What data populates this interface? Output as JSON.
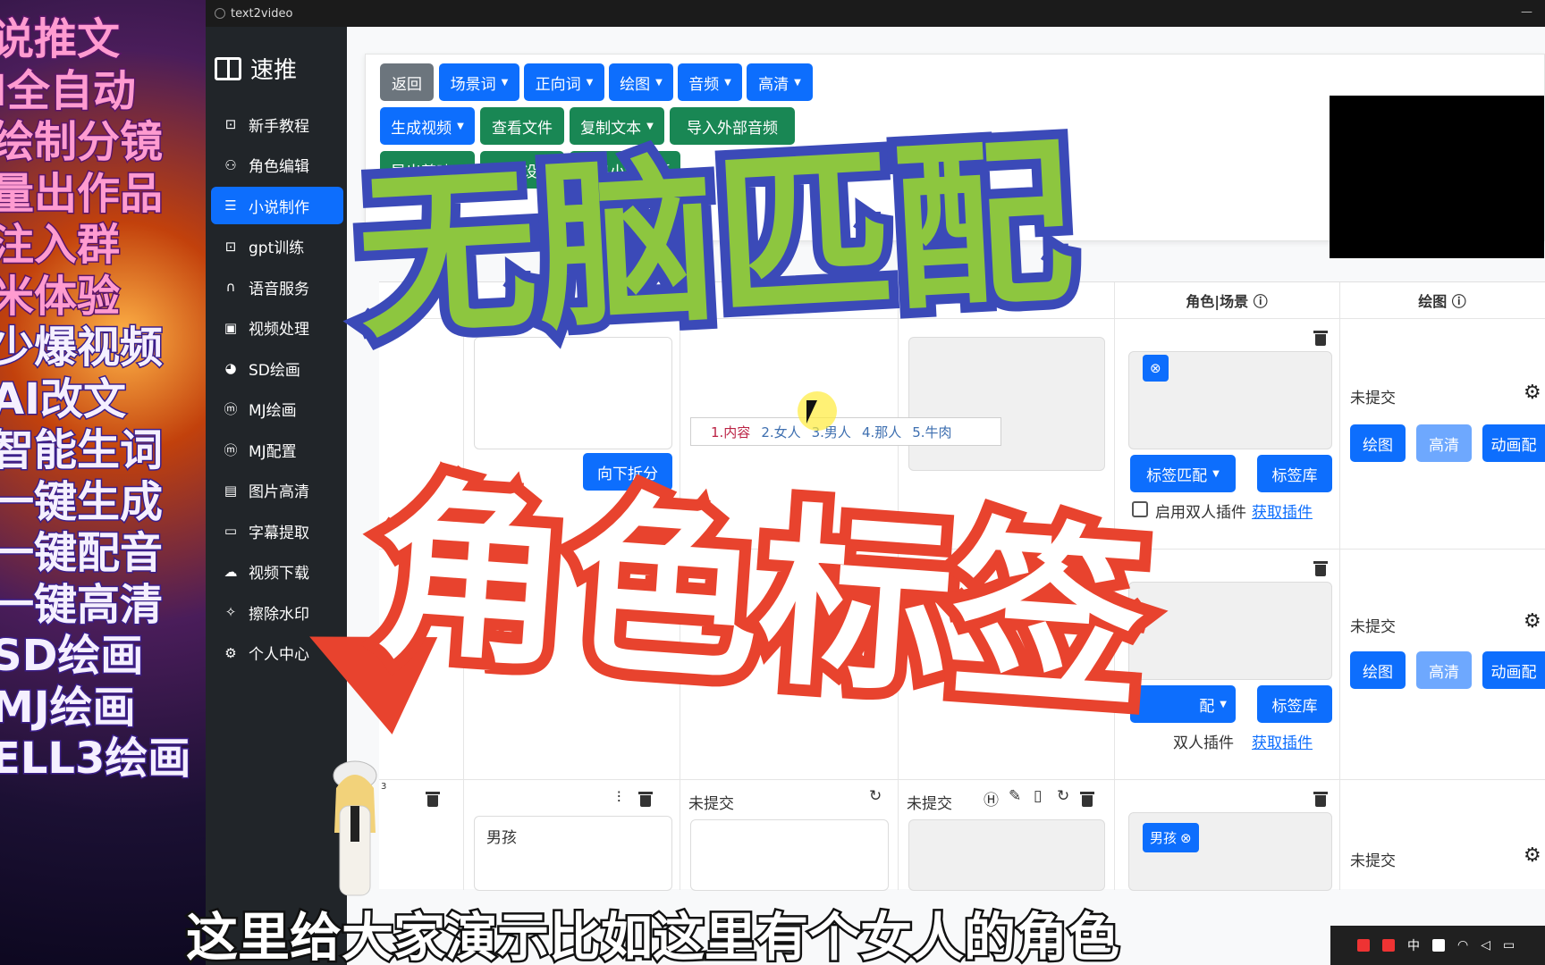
{
  "promo": {
    "lines": [
      "说推文",
      "I全自动",
      "绘制分镜",
      "量出作品",
      "注入群",
      "米体验",
      "少爆视频",
      "AI改文",
      "智能生词",
      "一键生成",
      "一键配音",
      "一键高清",
      "SD绘画",
      "MJ绘画",
      "ELL3绘画"
    ]
  },
  "window": {
    "title": "text2video"
  },
  "sidebar": {
    "brand": "速推",
    "items": [
      {
        "label": "新手教程",
        "icon": "robot-icon"
      },
      {
        "label": "角色编辑",
        "icon": "users-icon"
      },
      {
        "label": "小说制作",
        "icon": "list-icon",
        "active": true
      },
      {
        "label": "gpt训练",
        "icon": "robot-icon"
      },
      {
        "label": "语音服务",
        "icon": "headphones-icon"
      },
      {
        "label": "视频处理",
        "icon": "video-icon"
      },
      {
        "label": "SD绘画",
        "icon": "palette-icon"
      },
      {
        "label": "MJ绘画",
        "icon": "mastodon-icon"
      },
      {
        "label": "MJ配置",
        "icon": "mastodon-icon"
      },
      {
        "label": "图片高清",
        "icon": "8k-icon"
      },
      {
        "label": "字幕提取",
        "icon": "subtitle-icon"
      },
      {
        "label": "视频下载",
        "icon": "cloud-download-icon"
      },
      {
        "label": "擦除水印",
        "icon": "magic-icon"
      },
      {
        "label": "个人中心",
        "icon": "gear-icon"
      }
    ]
  },
  "toolbar": {
    "back": "返回",
    "scene_words": "场景词",
    "positive_words": "正向词",
    "draw": "绘图",
    "audio": "音频",
    "hd": "高清",
    "generate_video": "生成视频",
    "view_files": "查看文件",
    "copy_text": "复制文本",
    "import_audio": "导入外部音频",
    "export_jianying": "导出剪映",
    "novel_settings": "小说设置",
    "export_template": "导出小说模板"
  },
  "table": {
    "col_role_scene": "角色|场景",
    "col_draw": "绘图",
    "split_down": "向下拆分",
    "not_submitted": "未提交",
    "tag_match": "标签匹配",
    "tag_library": "标签库",
    "enable_dual": "启用双人插件",
    "get_plugin": "获取插件",
    "draw_btn": "绘图",
    "hd_btn": "高清",
    "animate_btn": "动画配",
    "row3_index": "3",
    "row3_text": "男孩",
    "row3_tag": "男孩",
    "row2_dual": "双人插件",
    "row2_match": "配"
  },
  "ime": {
    "candidates": [
      "1.内容",
      "2.女人",
      "3.男人",
      "4.那人",
      "5.牛肉"
    ]
  },
  "overlay": {
    "headline1": "无脑匹配",
    "headline2": "角色标签",
    "subtitle": "这里给大家演示比如这里有个女人的角色"
  },
  "taskbar": {
    "ime_mode": "中"
  },
  "colors": {
    "primary": "#0d6efd",
    "success": "#198754",
    "secondary": "#6c757d",
    "sidebar": "#212529",
    "overlay_green": "#8dc63f",
    "overlay_blue": "#3b4ab8",
    "overlay_red": "#e8432e"
  }
}
